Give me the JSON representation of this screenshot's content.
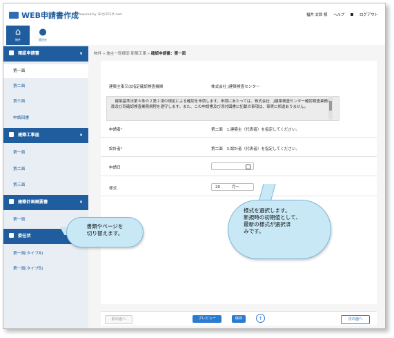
{
  "header": {
    "app_title": "WEB申請書作成",
    "powered_by": "Powered by 3Dカタログ.com",
    "user_name": "福井 太郎 様",
    "help": "ヘルプ",
    "logout": "ログアウト"
  },
  "iconbar": {
    "home_label": "物件",
    "person_label": "提出先"
  },
  "sidebar": {
    "sections": [
      {
        "title": "確認申請書",
        "items": [
          "第一面",
          "第二面",
          "第三面",
          "申請回書"
        ]
      },
      {
        "title": "建築工事届",
        "items": [
          "第一面",
          "第二面",
          "第三面"
        ]
      },
      {
        "title": "建築計画概要書",
        "items": [
          "第一面"
        ]
      },
      {
        "title": "委任状",
        "items": [
          "第一面(タイプA)",
          "第一面(タイプB)"
        ]
      }
    ]
  },
  "breadcrumb": {
    "a": "物件",
    "b": "施主一郎様邸",
    "c": "新築工事",
    "current": "確認申請書：第一面"
  },
  "form": {
    "org_label": "建築主事又は指定確認検査機関",
    "org_value": "株式会社 J建築検査センター",
    "notice": "　建築基準法第６条の２第１項の規定による確認を申請します。申請にあたっては、株式会社　J建築検査センター確認検査業務約款及び同確認検査業務規程を遵守します。また、この申請書及び添付図書に記載の事項は、事実に相違ありません。",
    "applicant_label": "申請者",
    "applicant_value": "第二面　1.建築主（代表者）を指定してください。",
    "designer_label": "設計者",
    "designer_value": "第二面　3.設計者（代表者）を指定してください。",
    "date_label": "申請日",
    "style_label": "様式",
    "style_value": "20　　　月〜"
  },
  "toolbar": {
    "prev": "前の面へ",
    "preview": "プレビュー",
    "save": "保存",
    "up": "↑",
    "next": "次の面へ"
  },
  "callouts": {
    "left": "書類やページを\n切り替えます。",
    "right": "様式を選択します。\n新規時の初期値として、\n最新の様式が選択済\nみです。"
  }
}
